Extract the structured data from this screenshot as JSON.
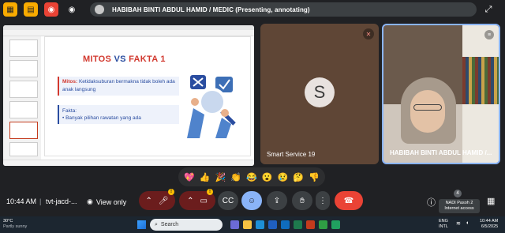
{
  "topbar": {
    "participant_label": "HABIBAH BINTI ABDUL HAMID / MEDIC (Presenting, annotating)",
    "colors": {
      "btn1": "#f9ab00",
      "btn2": "#f9ab00",
      "btn3": "#ea4335"
    }
  },
  "slide": {
    "title_left": "MITOS",
    "title_vs": "VS",
    "title_right": "FAKTA 1",
    "mitos_label": "Mitos:",
    "mitos_text": "Ketidaksuburan bermakna tidak boleh ada anak langsung",
    "fakta_label": "Fakta:",
    "fakta_item": "Banyak pilihan rawatan yang ada"
  },
  "tiles": [
    {
      "initial": "S",
      "name": "Smart Service 19",
      "muted": true
    },
    {
      "name": "HABIBAH BINTI ABDUL HAMID /..."
    }
  ],
  "reactions": [
    "💖",
    "👍",
    "🎉",
    "👏",
    "😂",
    "😮",
    "😢",
    "🤔",
    "👎"
  ],
  "bottombar": {
    "time": "10:44 AM",
    "separator": "|",
    "meeting_code": "tvt-jacd-...",
    "view_only": "View only",
    "people_count": "4",
    "tooltip_line1": "NADI Pasoh 2",
    "tooltip_line2": "Internet access"
  },
  "taskbar": {
    "temperature": "30°C",
    "condition": "Partly sunny",
    "search_placeholder": "Search",
    "lang1": "ENG",
    "lang2": "INTL",
    "clock_time": "10:44 AM",
    "clock_date": "6/5/2025"
  }
}
